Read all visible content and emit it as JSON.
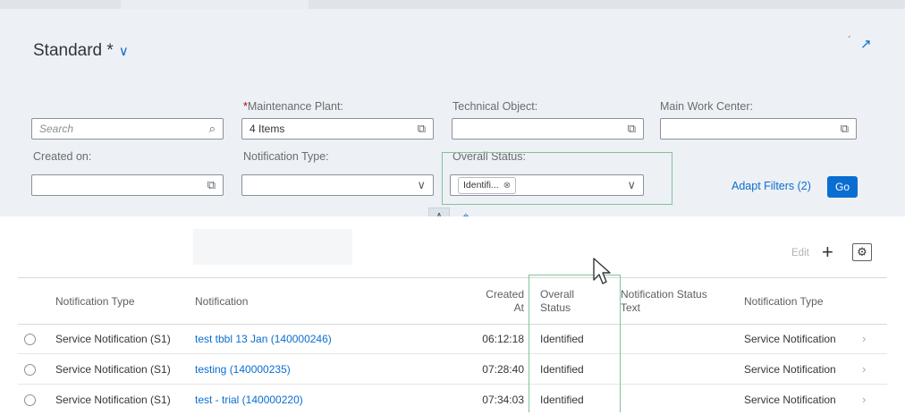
{
  "variant": {
    "title": "Standard *"
  },
  "filters": {
    "search_placeholder": "Search",
    "maintenance_plant": {
      "label_required": "*",
      "label": "Maintenance Plant:",
      "value": "4 Items"
    },
    "technical_object": {
      "label": "Technical Object:",
      "value": ""
    },
    "main_work_center": {
      "label": "Main Work Center:",
      "value": ""
    },
    "created_on": {
      "label": "Created on:",
      "value": ""
    },
    "notification_type": {
      "label": "Notification Type:",
      "value": ""
    },
    "overall_status": {
      "label": "Overall Status:",
      "token": "Identifi..."
    },
    "adapt_filters": "Adapt Filters (2)",
    "go": "Go"
  },
  "toolbar": {
    "edit": "Edit",
    "add": "+"
  },
  "table": {
    "columns": [
      "Notification Type",
      "Notification",
      "Created At",
      "Overall Status",
      "Notification Status Text",
      "Notification Type"
    ],
    "columns_split": {
      "created": [
        "Created",
        "At"
      ],
      "overall": [
        "Overall",
        "Status"
      ],
      "status_text": [
        "Notification Status",
        "Text"
      ]
    },
    "rows": [
      {
        "type": "Service Notification (S1)",
        "notification": "test tbbl 13 Jan (140000246)",
        "created_at": "06:12:18",
        "overall_status": "Identified",
        "status_text": "",
        "type2": "Service Notification"
      },
      {
        "type": "Service Notification (S1)",
        "notification": "testing (140000235)",
        "created_at": "07:28:40",
        "overall_status": "Identified",
        "status_text": "",
        "type2": "Service Notification"
      },
      {
        "type": "Service Notification (S1)",
        "notification": "test - trial (140000220)",
        "created_at": "07:34:03",
        "overall_status": "Identified",
        "status_text": "",
        "type2": "Service Notification"
      }
    ]
  },
  "icons": {
    "search": "search-icon",
    "value_help": "value-help-icon",
    "dropdown": "chevron-down-icon",
    "collapse": "chevron-up-icon",
    "pin": "pin-icon",
    "settings": "gear-icon",
    "share": "share-icon"
  },
  "colors": {
    "accent": "#0a6ed1",
    "highlight": "#7fc49a",
    "header_bg": "#edf0f4"
  }
}
